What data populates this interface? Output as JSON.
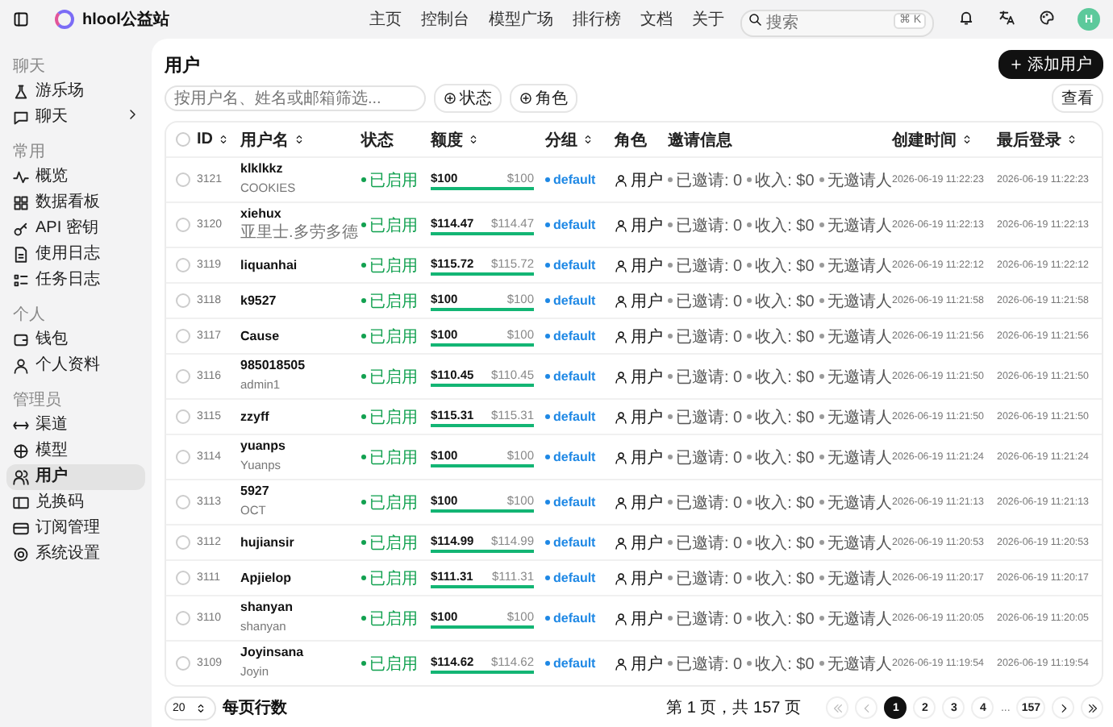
{
  "topbar": {
    "brand": "hlool公益站",
    "nav": [
      "主页",
      "控制台",
      "模型广场",
      "排行榜",
      "文档",
      "关于"
    ],
    "search": {
      "placeholder": "搜索",
      "shortcut": "⌘ K"
    },
    "avatar": "H"
  },
  "sidebar": {
    "sections": [
      {
        "title": "聊天",
        "items": [
          {
            "label": "游乐场",
            "selected": false,
            "expandable": false
          },
          {
            "label": "聊天",
            "selected": false,
            "expandable": true
          }
        ]
      },
      {
        "title": "常用",
        "items": [
          {
            "label": "概览",
            "selected": false,
            "expandable": false
          },
          {
            "label": "数据看板",
            "selected": false,
            "expandable": false
          },
          {
            "label": "API 密钥",
            "selected": false,
            "expandable": false
          },
          {
            "label": "使用日志",
            "selected": false,
            "expandable": false
          },
          {
            "label": "任务日志",
            "selected": false,
            "expandable": false
          }
        ]
      },
      {
        "title": "个人",
        "items": [
          {
            "label": "钱包",
            "selected": false,
            "expandable": false
          },
          {
            "label": "个人资料",
            "selected": false,
            "expandable": false
          }
        ]
      },
      {
        "title": "管理员",
        "items": [
          {
            "label": "渠道",
            "selected": false,
            "expandable": false
          },
          {
            "label": "模型",
            "selected": false,
            "expandable": false
          },
          {
            "label": "用户",
            "selected": true,
            "expandable": false
          },
          {
            "label": "兑换码",
            "selected": false,
            "expandable": false
          },
          {
            "label": "订阅管理",
            "selected": false,
            "expandable": false
          },
          {
            "label": "系统设置",
            "selected": false,
            "expandable": false
          }
        ]
      }
    ]
  },
  "page": {
    "title": "用户",
    "add_button": "添加用户",
    "filter": {
      "placeholder": "按用户名、姓名或邮箱筛选..."
    },
    "filter_buttons": [
      "状态",
      "角色"
    ],
    "view_button": "查看"
  },
  "table": {
    "all_selected": false,
    "columns": [
      {
        "label": "ID",
        "sortable": true
      },
      {
        "label": "用户名",
        "sortable": true
      },
      {
        "label": "状态",
        "sortable": false
      },
      {
        "label": "额度",
        "sortable": true
      },
      {
        "label": "分组",
        "sortable": true
      },
      {
        "label": "角色",
        "sortable": false
      },
      {
        "label": "邀请信息",
        "sortable": false
      },
      {
        "label": "创建时间",
        "sortable": true
      },
      {
        "label": "最后登录",
        "sortable": true
      }
    ],
    "rows": [
      {
        "id": "3121",
        "selected": false,
        "name": "klklkkz",
        "display_name": "COOKIES",
        "status": "已启用",
        "quota": "$100",
        "quota_total": "$100",
        "level": 1,
        "group": "default",
        "role": "用户",
        "invite": [
          "已邀请: 0",
          "收入: $0",
          "无邀请人"
        ],
        "created": "2026-06-19 11:22:23",
        "last_login": "2026-06-19 11:22:23"
      },
      {
        "id": "3120",
        "selected": false,
        "name": "xiehux",
        "display_name": "亚里士.多劳多德",
        "status": "已启用",
        "quota": "$114.47",
        "quota_total": "$114.47",
        "level": 1,
        "group": "default",
        "role": "用户",
        "invite": [
          "已邀请: 0",
          "收入: $0",
          "无邀请人"
        ],
        "created": "2026-06-19 11:22:13",
        "last_login": "2026-06-19 11:22:13"
      },
      {
        "id": "3119",
        "selected": false,
        "name": "liquanhai",
        "status": "已启用",
        "quota": "$115.72",
        "quota_total": "$115.72",
        "level": 1,
        "group": "default",
        "role": "用户",
        "invite": [
          "已邀请: 0",
          "收入: $0",
          "无邀请人"
        ],
        "created": "2026-06-19 11:22:12",
        "last_login": "2026-06-19 11:22:12"
      },
      {
        "id": "3118",
        "selected": false,
        "name": "k9527",
        "status": "已启用",
        "quota": "$100",
        "quota_total": "$100",
        "level": 1,
        "group": "default",
        "role": "用户",
        "invite": [
          "已邀请: 0",
          "收入: $0",
          "无邀请人"
        ],
        "created": "2026-06-19 11:21:58",
        "last_login": "2026-06-19 11:21:58"
      },
      {
        "id": "3117",
        "selected": false,
        "name": "Cause",
        "status": "已启用",
        "quota": "$100",
        "quota_total": "$100",
        "level": 1,
        "group": "default",
        "role": "用户",
        "invite": [
          "已邀请: 0",
          "收入: $0",
          "无邀请人"
        ],
        "created": "2026-06-19 11:21:56",
        "last_login": "2026-06-19 11:21:56"
      },
      {
        "id": "3116",
        "selected": false,
        "name": "985018505",
        "display_name": "admin1",
        "status": "已启用",
        "quota": "$110.45",
        "quota_total": "$110.45",
        "level": 1,
        "group": "default",
        "role": "用户",
        "invite": [
          "已邀请: 0",
          "收入: $0",
          "无邀请人"
        ],
        "created": "2026-06-19 11:21:50",
        "last_login": "2026-06-19 11:21:50"
      },
      {
        "id": "3115",
        "selected": false,
        "name": "zzyff",
        "status": "已启用",
        "quota": "$115.31",
        "quota_total": "$115.31",
        "level": 1,
        "group": "default",
        "role": "用户",
        "invite": [
          "已邀请: 0",
          "收入: $0",
          "无邀请人"
        ],
        "created": "2026-06-19 11:21:50",
        "last_login": "2026-06-19 11:21:50"
      },
      {
        "id": "3114",
        "selected": false,
        "name": "yuanps",
        "display_name": "Yuanps",
        "status": "已启用",
        "quota": "$100",
        "quota_total": "$100",
        "level": 1,
        "group": "default",
        "role": "用户",
        "invite": [
          "已邀请: 0",
          "收入: $0",
          "无邀请人"
        ],
        "created": "2026-06-19 11:21:24",
        "last_login": "2026-06-19 11:21:24"
      },
      {
        "id": "3113",
        "selected": false,
        "name": "5927",
        "display_name": "OCT",
        "status": "已启用",
        "quota": "$100",
        "quota_total": "$100",
        "level": 1,
        "group": "default",
        "role": "用户",
        "invite": [
          "已邀请: 0",
          "收入: $0",
          "无邀请人"
        ],
        "created": "2026-06-19 11:21:13",
        "last_login": "2026-06-19 11:21:13"
      },
      {
        "id": "3112",
        "selected": false,
        "name": "hujiansir",
        "status": "已启用",
        "quota": "$114.99",
        "quota_total": "$114.99",
        "level": 1,
        "group": "default",
        "role": "用户",
        "invite": [
          "已邀请: 0",
          "收入: $0",
          "无邀请人"
        ],
        "created": "2026-06-19 11:20:53",
        "last_login": "2026-06-19 11:20:53"
      },
      {
        "id": "3111",
        "selected": false,
        "name": "Apjielop",
        "status": "已启用",
        "quota": "$111.31",
        "quota_total": "$111.31",
        "level": 1,
        "group": "default",
        "role": "用户",
        "invite": [
          "已邀请: 0",
          "收入: $0",
          "无邀请人"
        ],
        "created": "2026-06-19 11:20:17",
        "last_login": "2026-06-19 11:20:17"
      },
      {
        "id": "3110",
        "selected": false,
        "name": "shanyan",
        "display_name": "shanyan",
        "status": "已启用",
        "quota": "$100",
        "quota_total": "$100",
        "level": 1,
        "group": "default",
        "role": "用户",
        "invite": [
          "已邀请: 0",
          "收入: $0",
          "无邀请人"
        ],
        "created": "2026-06-19 11:20:05",
        "last_login": "2026-06-19 11:20:05"
      },
      {
        "id": "3109",
        "selected": false,
        "name": "Joyinsana",
        "display_name": "Joyin",
        "status": "已启用",
        "quota": "$114.62",
        "quota_total": "$114.62",
        "level": 1,
        "group": "default",
        "role": "用户",
        "invite": [
          "已邀请: 0",
          "收入: $0",
          "无邀请人"
        ],
        "created": "2026-06-19 11:19:54",
        "last_login": "2026-06-19 11:19:54"
      }
    ]
  },
  "pagination": {
    "rows_per_page": "20",
    "rows_per_page_label": "每页行数",
    "page_info": "第 1 页，共 157 页",
    "pages": [
      {
        "label": "1",
        "kind": "page",
        "selected": true
      },
      {
        "label": "2",
        "kind": "page",
        "selected": false
      },
      {
        "label": "3",
        "kind": "page",
        "selected": false
      },
      {
        "label": "4",
        "kind": "page",
        "selected": false
      },
      {
        "label": "...",
        "kind": "gap"
      },
      {
        "label": "157",
        "kind": "page",
        "selected": false
      }
    ]
  }
}
